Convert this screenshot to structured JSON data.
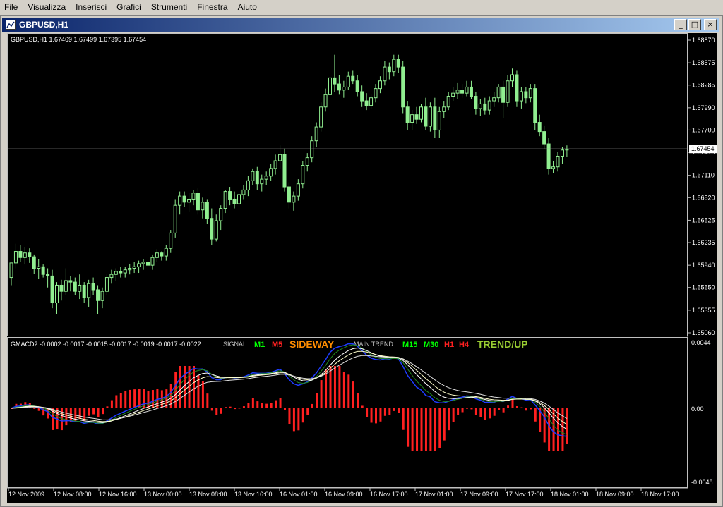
{
  "menu": [
    "File",
    "Visualizza",
    "Inserisci",
    "Grafici",
    "Strumenti",
    "Finestra",
    "Aiuto"
  ],
  "window": {
    "title": "GBPUSD,H1",
    "buttons": {
      "minimize": "_",
      "maximize": "□",
      "close": "×"
    }
  },
  "colors": {
    "bull": "#90ee90",
    "bear": "#000000",
    "hist": "#ff2020",
    "background": "#000000"
  },
  "main_chart": {
    "info": "GBPUSD,H1  1.67469 1.67499 1.67395 1.67454",
    "price_ticks": [
      "1.68870",
      "1.68575",
      "1.68285",
      "1.67990",
      "1.67700",
      "1.67410",
      "1.67110",
      "1.66820",
      "1.66525",
      "1.66235",
      "1.65940",
      "1.65650",
      "1.65355",
      "1.65060"
    ],
    "current_price": "1.67454",
    "current_price_value": 1.67454
  },
  "indicator": {
    "info": "GMACD2 -0.0002 -0.0017 -0.0015 -0.0017 -0.0019 -0.0017 -0.0022",
    "signal_label": "SIGNAL",
    "signal_tfs": [
      {
        "text": "M1",
        "color": "#00ff00"
      },
      {
        "text": "M5",
        "color": "#ff2020"
      }
    ],
    "signal_state": "SIDEWAY",
    "signal_state_color": "#ff8c00",
    "trend_label": "MAIN TREND",
    "trend_tfs": [
      {
        "text": "M15",
        "color": "#00ff00"
      },
      {
        "text": "M30",
        "color": "#00ff00"
      },
      {
        "text": "H1",
        "color": "#ff2020"
      },
      {
        "text": "H4",
        "color": "#ff2020"
      }
    ],
    "trend_state": "TREND/UP",
    "trend_state_color": "#9acd32",
    "ticks": [
      "0.0044",
      "0.00",
      "-0.0048"
    ]
  },
  "time_axis": [
    "12 Nov 2009",
    "12 Nov 08:00",
    "12 Nov 16:00",
    "13 Nov 00:00",
    "13 Nov 08:00",
    "13 Nov 16:00",
    "16 Nov 01:00",
    "16 Nov 09:00",
    "16 Nov 17:00",
    "17 Nov 01:00",
    "17 Nov 09:00",
    "17 Nov 17:00",
    "18 Nov 01:00",
    "18 Nov 09:00",
    "18 Nov 17:00"
  ],
  "chart_data": {
    "type": "candlestick",
    "title": "GBPUSD,H1",
    "ylim": [
      1.6506,
      1.6887
    ],
    "candles": [
      [
        1.6578,
        1.6597,
        1.6568,
        1.6597
      ],
      [
        1.6597,
        1.6622,
        1.659,
        1.6612
      ],
      [
        1.6612,
        1.662,
        1.6598,
        1.6604
      ],
      [
        1.6604,
        1.6618,
        1.6595,
        1.661
      ],
      [
        1.661,
        1.6616,
        1.6597,
        1.6605
      ],
      [
        1.6605,
        1.6608,
        1.6583,
        1.659
      ],
      [
        1.659,
        1.6602,
        1.6576,
        1.6592
      ],
      [
        1.6592,
        1.6595,
        1.6578,
        1.6582
      ],
      [
        1.6582,
        1.659,
        1.6565,
        1.658
      ],
      [
        1.658,
        1.6588,
        1.6538,
        1.6545
      ],
      [
        1.6545,
        1.6572,
        1.653,
        1.6568
      ],
      [
        1.6568,
        1.6575,
        1.6548,
        1.656
      ],
      [
        1.656,
        1.659,
        1.6555,
        1.6574
      ],
      [
        1.6574,
        1.658,
        1.656,
        1.6572
      ],
      [
        1.6572,
        1.6578,
        1.6555,
        1.656
      ],
      [
        1.656,
        1.6582,
        1.655,
        1.6568
      ],
      [
        1.6568,
        1.6572,
        1.6545,
        1.6552
      ],
      [
        1.6552,
        1.6575,
        1.654,
        1.657
      ],
      [
        1.657,
        1.6578,
        1.6555,
        1.6562
      ],
      [
        1.6562,
        1.6568,
        1.653,
        1.6548
      ],
      [
        1.6548,
        1.6565,
        1.6538,
        1.656
      ],
      [
        1.656,
        1.6582,
        1.6555,
        1.6578
      ],
      [
        1.6578,
        1.6588,
        1.657,
        1.6582
      ],
      [
        1.6582,
        1.659,
        1.6574,
        1.6586
      ],
      [
        1.6586,
        1.6592,
        1.6578,
        1.6584
      ],
      [
        1.6584,
        1.6592,
        1.6578,
        1.6588
      ],
      [
        1.6588,
        1.6596,
        1.6582,
        1.659
      ],
      [
        1.659,
        1.6598,
        1.6584,
        1.6592
      ],
      [
        1.6592,
        1.66,
        1.6584,
        1.6596
      ],
      [
        1.6596,
        1.6602,
        1.6588,
        1.6598
      ],
      [
        1.6598,
        1.6606,
        1.659,
        1.6594
      ],
      [
        1.6594,
        1.6608,
        1.6588,
        1.6604
      ],
      [
        1.6604,
        1.6615,
        1.6598,
        1.661
      ],
      [
        1.661,
        1.6612,
        1.66,
        1.6606
      ],
      [
        1.6606,
        1.662,
        1.66,
        1.6616
      ],
      [
        1.6616,
        1.664,
        1.661,
        1.6636
      ],
      [
        1.6636,
        1.668,
        1.663,
        1.6672
      ],
      [
        1.6672,
        1.669,
        1.666,
        1.6684
      ],
      [
        1.6684,
        1.669,
        1.667,
        1.6676
      ],
      [
        1.6676,
        1.6688,
        1.6664,
        1.668
      ],
      [
        1.668,
        1.6692,
        1.6672,
        1.6688
      ],
      [
        1.6688,
        1.6694,
        1.666,
        1.6666
      ],
      [
        1.6666,
        1.6682,
        1.6655,
        1.6676
      ],
      [
        1.6676,
        1.668,
        1.6648,
        1.6655
      ],
      [
        1.6655,
        1.6668,
        1.662,
        1.6628
      ],
      [
        1.6628,
        1.666,
        1.6625,
        1.6652
      ],
      [
        1.6652,
        1.6672,
        1.664,
        1.6668
      ],
      [
        1.6668,
        1.6692,
        1.6662,
        1.669
      ],
      [
        1.669,
        1.6696,
        1.6672,
        1.668
      ],
      [
        1.668,
        1.669,
        1.6668,
        1.6674
      ],
      [
        1.6674,
        1.6688,
        1.6668,
        1.6686
      ],
      [
        1.6686,
        1.6698,
        1.668,
        1.6692
      ],
      [
        1.6692,
        1.671,
        1.6684,
        1.6704
      ],
      [
        1.6704,
        1.672,
        1.6698,
        1.6716
      ],
      [
        1.6716,
        1.6722,
        1.6692,
        1.67
      ],
      [
        1.67,
        1.6712,
        1.669,
        1.6706
      ],
      [
        1.6706,
        1.6716,
        1.6698,
        1.671
      ],
      [
        1.671,
        1.6726,
        1.6704,
        1.672
      ],
      [
        1.672,
        1.6738,
        1.6712,
        1.673
      ],
      [
        1.673,
        1.675,
        1.672,
        1.6738
      ],
      [
        1.6738,
        1.6746,
        1.669,
        1.6696
      ],
      [
        1.6696,
        1.6702,
        1.6668,
        1.6676
      ],
      [
        1.6676,
        1.669,
        1.6665,
        1.6684
      ],
      [
        1.6684,
        1.6706,
        1.6678,
        1.67
      ],
      [
        1.67,
        1.673,
        1.6694,
        1.6724
      ],
      [
        1.6724,
        1.674,
        1.6716,
        1.6734
      ],
      [
        1.6734,
        1.6762,
        1.6728,
        1.6756
      ],
      [
        1.6756,
        1.678,
        1.6748,
        1.6774
      ],
      [
        1.6774,
        1.6806,
        1.6768,
        1.68
      ],
      [
        1.68,
        1.6824,
        1.6794,
        1.6816
      ],
      [
        1.6816,
        1.6846,
        1.681,
        1.6838
      ],
      [
        1.6838,
        1.6868,
        1.682,
        1.683
      ],
      [
        1.683,
        1.6842,
        1.6816,
        1.6822
      ],
      [
        1.6822,
        1.6834,
        1.6812,
        1.6826
      ],
      [
        1.6826,
        1.6846,
        1.6822,
        1.684
      ],
      [
        1.684,
        1.6848,
        1.683,
        1.6834
      ],
      [
        1.6834,
        1.6842,
        1.6814,
        1.682
      ],
      [
        1.682,
        1.6828,
        1.68,
        1.6808
      ],
      [
        1.6808,
        1.6818,
        1.6796,
        1.6802
      ],
      [
        1.6802,
        1.6816,
        1.6798,
        1.6812
      ],
      [
        1.6812,
        1.683,
        1.6806,
        1.6824
      ],
      [
        1.6824,
        1.684,
        1.6818,
        1.6834
      ],
      [
        1.6834,
        1.686,
        1.6828,
        1.6852
      ],
      [
        1.6852,
        1.6858,
        1.6836,
        1.6846
      ],
      [
        1.6846,
        1.6868,
        1.684,
        1.6862
      ],
      [
        1.6862,
        1.6868,
        1.6844,
        1.6852
      ],
      [
        1.6852,
        1.686,
        1.6792,
        1.68
      ],
      [
        1.68,
        1.6808,
        1.677,
        1.678
      ],
      [
        1.678,
        1.6796,
        1.677,
        1.679
      ],
      [
        1.679,
        1.68,
        1.6778,
        1.6784
      ],
      [
        1.6784,
        1.6804,
        1.678,
        1.68
      ],
      [
        1.68,
        1.6812,
        1.677,
        1.6775
      ],
      [
        1.6775,
        1.6806,
        1.6768,
        1.68
      ],
      [
        1.68,
        1.6812,
        1.676,
        1.677
      ],
      [
        1.677,
        1.68,
        1.676,
        1.6794
      ],
      [
        1.6794,
        1.6808,
        1.6786,
        1.68
      ],
      [
        1.68,
        1.682,
        1.6796,
        1.6814
      ],
      [
        1.6814,
        1.6826,
        1.6808,
        1.6818
      ],
      [
        1.6818,
        1.6832,
        1.681,
        1.6822
      ],
      [
        1.6822,
        1.683,
        1.6812,
        1.6818
      ],
      [
        1.6818,
        1.6834,
        1.6814,
        1.6826
      ],
      [
        1.6826,
        1.6834,
        1.681,
        1.6814
      ],
      [
        1.6814,
        1.682,
        1.679,
        1.6798
      ],
      [
        1.6798,
        1.681,
        1.6788,
        1.6804
      ],
      [
        1.6804,
        1.6812,
        1.679,
        1.6796
      ],
      [
        1.6796,
        1.6814,
        1.679,
        1.6808
      ],
      [
        1.6808,
        1.682,
        1.68,
        1.6812
      ],
      [
        1.6812,
        1.683,
        1.6806,
        1.6826
      ],
      [
        1.6826,
        1.6834,
        1.6786,
        1.6806
      ],
      [
        1.6806,
        1.6842,
        1.68,
        1.6834
      ],
      [
        1.6834,
        1.685,
        1.6826,
        1.6842
      ],
      [
        1.6842,
        1.6848,
        1.68,
        1.6808
      ],
      [
        1.6808,
        1.6826,
        1.6798,
        1.682
      ],
      [
        1.682,
        1.6826,
        1.6805,
        1.6812
      ],
      [
        1.6812,
        1.683,
        1.6806,
        1.6824
      ],
      [
        1.6824,
        1.683,
        1.677,
        1.678
      ],
      [
        1.678,
        1.679,
        1.6762,
        1.6768
      ],
      [
        1.6768,
        1.6776,
        1.6745,
        1.6752
      ],
      [
        1.6752,
        1.676,
        1.6712,
        1.672
      ],
      [
        1.672,
        1.673,
        1.6714,
        1.6722
      ],
      [
        1.6722,
        1.6742,
        1.6716,
        1.6736
      ],
      [
        1.6736,
        1.6748,
        1.6726,
        1.6744
      ],
      [
        1.6744,
        1.675,
        1.6735,
        1.6745
      ]
    ]
  }
}
